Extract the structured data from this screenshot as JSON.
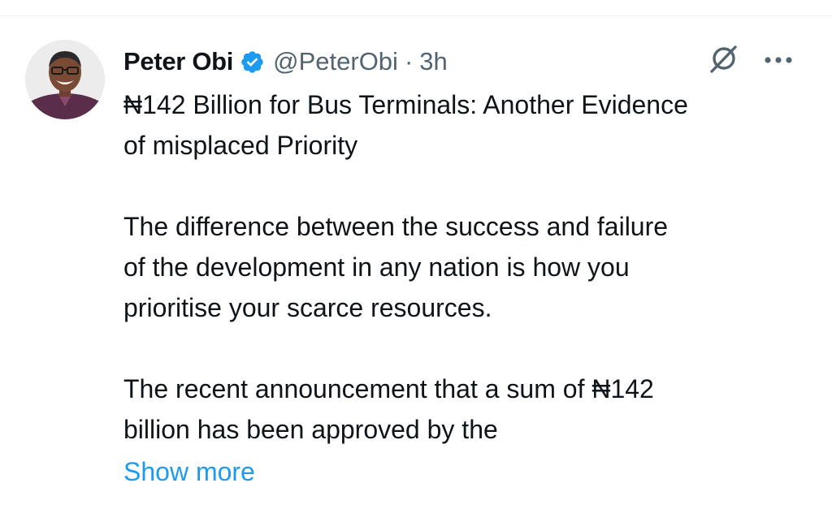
{
  "tweet": {
    "author_name": "Peter Obi",
    "handle": "@PeterObi",
    "separator": "·",
    "time": "3h",
    "paragraphs": [
      [
        "₦142 Billion for Bus Terminals: Another Evidence",
        "of misplaced Priority"
      ],
      [
        "The difference between the success and failure",
        "of the development in any nation is how you",
        "prioritise your scarce resources."
      ],
      [
        "The recent announcement that a sum of ₦142",
        "billion has been approved by the"
      ]
    ],
    "show_more_label": "Show more"
  },
  "icons": {
    "verified": "verified-badge-icon",
    "grok": "grok-icon",
    "more": "more-horizontal-icon"
  },
  "colors": {
    "text": "#0f1419",
    "secondary": "#536471",
    "link": "#1d9bf0",
    "verified": "#1d9bf0"
  }
}
